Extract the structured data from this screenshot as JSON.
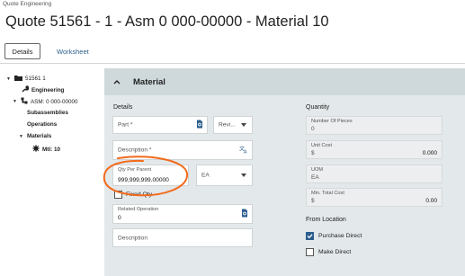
{
  "app": {
    "name": "Quote Engineering"
  },
  "page": {
    "title": "Quote 51561 - 1 - Asm 0 000-00000 - Material 10"
  },
  "tabs": {
    "details": "Details",
    "worksheet": "Worksheet"
  },
  "tree": {
    "root": "51561 1",
    "engineering": "Engineering",
    "asm": "ASM: 0 000-00000",
    "subassemblies": "Subassemblies",
    "operations": "Operations",
    "materials": "Materials",
    "mtl": "Mtl: 10"
  },
  "section": {
    "title": "Material"
  },
  "details": {
    "title": "Details",
    "part_placeholder": "Part *",
    "revision_placeholder": "Revi...",
    "description_placeholder": "Description *",
    "qty_label": "Qty Per Parent",
    "qty_value": "999,999,999.00000",
    "uom_value": "EA",
    "fixed_qty_label": "Fixed Qty",
    "related_op_label": "Related Operation",
    "related_op_value": "0",
    "description2_placeholder": "Description"
  },
  "quantity": {
    "title": "Quantity",
    "pieces_label": "Number Of Pieces",
    "pieces_value": "0",
    "unit_cost_label": "Unit Cost",
    "unit_cost_currency": "$",
    "unit_cost_value": "0.000",
    "uom_label": "UOM",
    "uom_value": "EA",
    "min_cost_label": "Min. Total Cost",
    "min_cost_currency": "$",
    "min_cost_value": "0.00"
  },
  "from_location": {
    "title": "From Location",
    "purchase_direct": "Purchase Direct",
    "purchase_direct_checked": true,
    "make_direct": "Make Direct",
    "make_direct_checked": false
  },
  "colors": {
    "accent": "#2b5e8c",
    "annotation": "#f26a1b",
    "panel": "#e3e8ea",
    "header": "#cfd9dc"
  }
}
